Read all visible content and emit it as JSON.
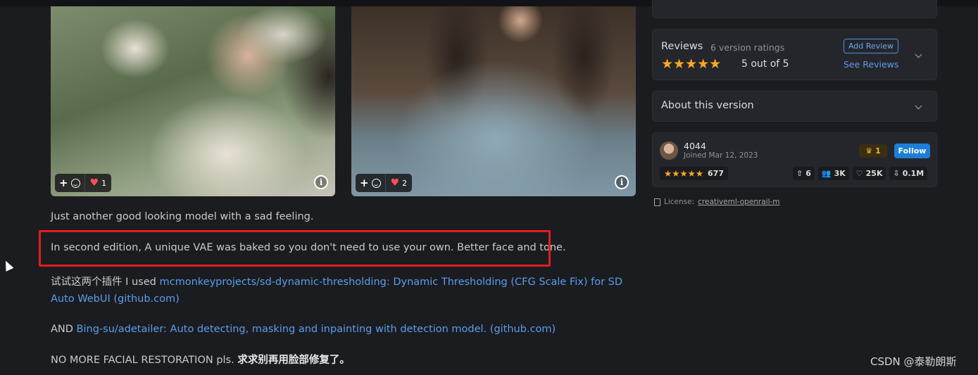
{
  "gallery": [
    {
      "reaction_count": "1"
    },
    {
      "reaction_count": "2"
    }
  ],
  "description": {
    "p1": "Just another good looking model with a sad feeling.",
    "p2": "In second edition, A unique VAE was baked so you don't need to use your own. Better face and tone.",
    "p3_prefix": "试试这两个插件 I used ",
    "p3_link": "mcmonkeyprojects/sd-dynamic-thresholding: Dynamic Thresholding (CFG Scale Fix) for SD Auto WebUI (github.com)",
    "p4_prefix": "AND ",
    "p4_link": "Bing-su/adetailer: Auto detecting, masking and inpainting with detection model. (github.com)",
    "p5_prefix": "NO MORE FACIAL RESTORATION pls. ",
    "p5_bold": "求求别再用脸部修复了。"
  },
  "reviews": {
    "title": "Reviews",
    "count": "6 version ratings",
    "stars": "★★★★★",
    "rating_text": "5 out of 5",
    "add_review": "Add Review",
    "see_reviews": "See Reviews"
  },
  "about": {
    "title": "About this version"
  },
  "creator": {
    "name": "4044",
    "joined": "Joined Mar 12, 2023",
    "crown_count": "1",
    "follow": "Follow",
    "stars": "★★★★★",
    "rating_count": "677",
    "stats": [
      {
        "icon": "upload-icon",
        "glyph": "⇧",
        "value": "6"
      },
      {
        "icon": "users-icon",
        "glyph": "👥",
        "value": "3K"
      },
      {
        "icon": "heart-outline-icon",
        "glyph": "♡",
        "value": "25K"
      },
      {
        "icon": "download-icon",
        "glyph": "⇩",
        "value": "0.1M"
      }
    ]
  },
  "license": {
    "label": "License:",
    "value": "creativeml-openrail-m"
  },
  "watermark": "CSDN @泰勒朗斯"
}
